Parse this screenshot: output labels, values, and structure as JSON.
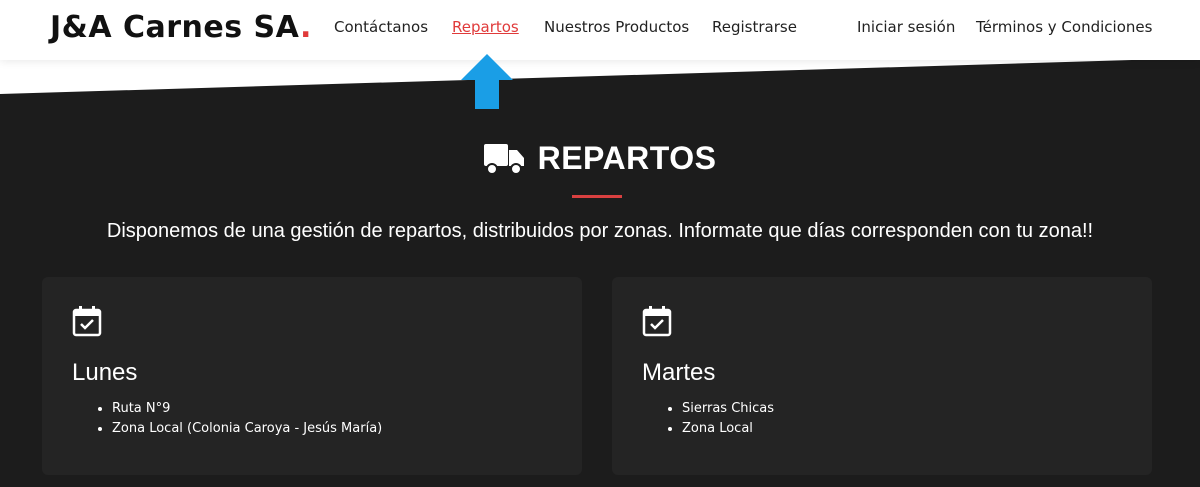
{
  "header": {
    "logo_text": "J&A Carnes SA",
    "logo_dot": ".",
    "nav": [
      {
        "label": "Contáctanos"
      },
      {
        "label": "Repartos"
      },
      {
        "label": "Nuestros Productos"
      },
      {
        "label": "Registrarse"
      },
      {
        "label": "Iniciar sesión"
      },
      {
        "label": "Términos y Condiciones"
      }
    ],
    "active_nav": "Repartos"
  },
  "section": {
    "icon": "truck-icon",
    "title": "REPARTOS",
    "subtitle": "Disponemos de una gestión de repartos, distribuidos por zonas. Informate que días corresponden con tu zona!!"
  },
  "cards": [
    {
      "icon": "calendar-check-icon",
      "day": "Lunes",
      "items": [
        "Ruta N°9",
        "Zona Local (Colonia Caroya - Jesús María)"
      ]
    },
    {
      "icon": "calendar-check-icon",
      "day": "Martes",
      "items": [
        "Sierras Chicas",
        "Zona Local"
      ]
    }
  ],
  "colors": {
    "accent": "#e03a3a",
    "background": "#1c1c1c",
    "card": "#242424",
    "arrow": "#1a9ee6"
  }
}
